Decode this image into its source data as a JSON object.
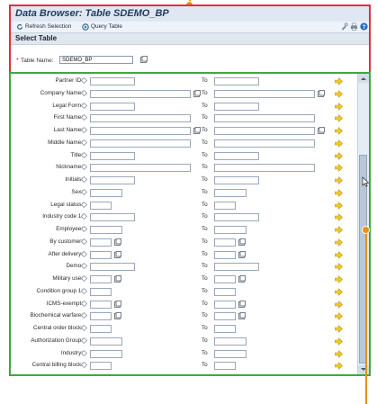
{
  "window": {
    "title": "Data Browser: Table SDEMO_BP"
  },
  "toolbar": {
    "refresh_label": "Refresh Selection",
    "query_label": "Query Table"
  },
  "section": {
    "title": "Select Table"
  },
  "table_field": {
    "label": "Table Name:",
    "value": "SDEMO_BP"
  },
  "criteria": {
    "to_label": "To",
    "rows": [
      {
        "label": "Partner ID:",
        "from_size": "md",
        "from_f4": false,
        "to_size": "md",
        "to_f4": false
      },
      {
        "label": "Company Name:",
        "from_size": "xl",
        "from_f4": true,
        "to_size": "xl",
        "to_f4": true
      },
      {
        "label": "Legal Form:",
        "from_size": "md",
        "from_f4": false,
        "to_size": "md",
        "to_f4": false
      },
      {
        "label": "First Name:",
        "from_size": "xl",
        "from_f4": false,
        "to_size": "xl",
        "to_f4": false
      },
      {
        "label": "Last Name:",
        "from_size": "xl",
        "from_f4": true,
        "to_size": "xl",
        "to_f4": true
      },
      {
        "label": "Middle Name:",
        "from_size": "xl",
        "from_f4": false,
        "to_size": "xl",
        "to_f4": false
      },
      {
        "label": "Title:",
        "from_size": "md",
        "from_f4": false,
        "to_size": "md",
        "to_f4": false
      },
      {
        "label": "Nickname:",
        "from_size": "xl",
        "from_f4": false,
        "to_size": "xl",
        "to_f4": false
      },
      {
        "label": "Initials:",
        "from_size": "md",
        "from_f4": false,
        "to_size": "md",
        "to_f4": false
      },
      {
        "label": "Sex:",
        "from_size": "sm",
        "from_f4": false,
        "to_size": "sm",
        "to_f4": false
      },
      {
        "label": "Legal status:",
        "from_size": "xs",
        "from_f4": false,
        "to_size": "xs",
        "to_f4": false
      },
      {
        "label": "Industry code 1:",
        "from_size": "md",
        "from_f4": false,
        "to_size": "md",
        "to_f4": false
      },
      {
        "label": "Employee:",
        "from_size": "sm",
        "from_f4": false,
        "to_size": "sm",
        "to_f4": false
      },
      {
        "label": "By customer:",
        "from_size": "xs",
        "from_f4": true,
        "to_size": "xs",
        "to_f4": true
      },
      {
        "label": "After delivery:",
        "from_size": "xs",
        "from_f4": true,
        "to_size": "xs",
        "to_f4": true
      },
      {
        "label": "Demo:",
        "from_size": "md",
        "from_f4": false,
        "to_size": "md",
        "to_f4": false
      },
      {
        "label": "Military use:",
        "from_size": "xs",
        "from_f4": true,
        "to_size": "xs",
        "to_f4": true
      },
      {
        "label": "Condition group 1:",
        "from_size": "xs",
        "from_f4": false,
        "to_size": "xs",
        "to_f4": false
      },
      {
        "label": "ICMS-exempt:",
        "from_size": "xs",
        "from_f4": true,
        "to_size": "xs",
        "to_f4": true
      },
      {
        "label": "Biochemical warfare:",
        "from_size": "xs",
        "from_f4": true,
        "to_size": "xs",
        "to_f4": true
      },
      {
        "label": "Central order block:",
        "from_size": "xs",
        "from_f4": false,
        "to_size": "xs",
        "to_f4": false
      },
      {
        "label": "Authorization Group:",
        "from_size": "sm",
        "from_f4": false,
        "to_size": "sm",
        "to_f4": false
      },
      {
        "label": "Industry:",
        "from_size": "sm",
        "from_f4": false,
        "to_size": "sm",
        "to_f4": false
      },
      {
        "label": "Central billing block:",
        "from_size": "xs",
        "from_f4": false,
        "to_size": "xs",
        "to_f4": false
      }
    ]
  },
  "colors": {
    "header_border": "#e0303a",
    "criteria_border": "#3caa3c",
    "callout": "#e8901a",
    "title_text": "#213c60"
  }
}
